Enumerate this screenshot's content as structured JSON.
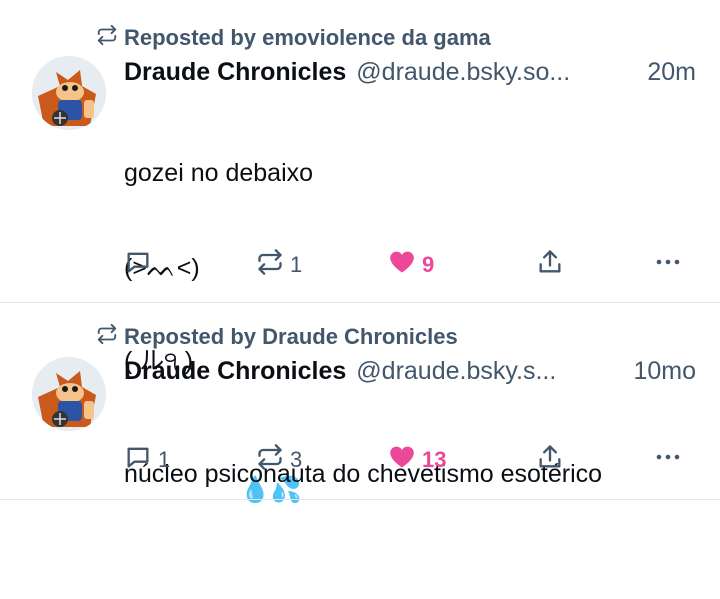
{
  "posts": [
    {
      "repost_label": "Reposted by emoviolence da gama",
      "author_name": "Draude Chronicles",
      "author_handle": "@draude.bsky.so...",
      "time": "20m",
      "text_lines": [
        "gozei no debaixo",
        "(>ᨓ<)",
        "( ル੧ )"
      ],
      "emoji": "💧💦",
      "reply_count": "",
      "repost_count": "1",
      "like_count": "9",
      "liked": true
    },
    {
      "repost_label": "Reposted by Draude Chronicles",
      "author_name": "Draude Chronicles",
      "author_handle": "@draude.bsky.s...",
      "time": "10mo",
      "text_lines": [
        "núcleo psiconauta do chevetismo esotérico"
      ],
      "reply_count": "1",
      "repost_count": "3",
      "like_count": "13",
      "liked": true
    }
  ],
  "colors": {
    "muted": "#42576c",
    "like": "#ec4899",
    "border": "#e4e8ec"
  },
  "icons": [
    "repost-icon",
    "reply-icon",
    "heart-icon",
    "share-icon",
    "more-icon"
  ]
}
